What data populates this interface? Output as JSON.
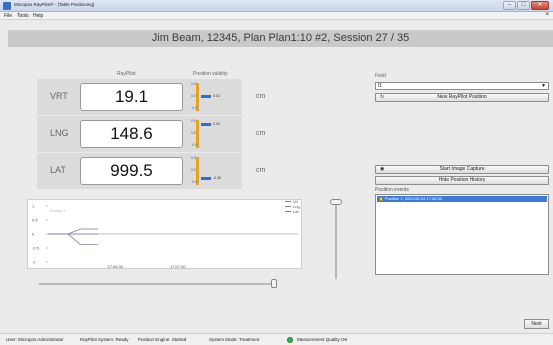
{
  "window": {
    "title": "Micropos RayPilot® - [Table Positioning]"
  },
  "menu": [
    "File",
    "Tools",
    "Help"
  ],
  "session_title": "Jim Beam, 12345, Plan Plan1:10 #2, Session 27 / 35",
  "columns": {
    "raypilot": "RayPilot",
    "position_validity": "Position validity"
  },
  "measurements": [
    {
      "axis": "VRT",
      "value": "19.1",
      "unit": "cm",
      "gauge_ticks": [
        "0.5",
        "0.0",
        "-0.5"
      ],
      "indicator_value": "0.02"
    },
    {
      "axis": "LNG",
      "value": "148.6",
      "unit": "cm",
      "gauge_ticks": [
        "0.5",
        "0.0",
        "-0.5"
      ],
      "indicator_value": "0.00"
    },
    {
      "axis": "LAT",
      "value": "999.5",
      "unit": "cm",
      "gauge_ticks": [
        "0.5",
        "0.0",
        "-0.5"
      ],
      "indicator_value": "-0.38"
    }
  ],
  "chart_data": {
    "type": "line",
    "y_ticks": [
      "1",
      "0.5",
      "0",
      "-0.5",
      "-1"
    ],
    "ylim": [
      -1,
      1
    ],
    "x_ticks": [
      "17:06:30",
      "17:07:00"
    ],
    "annotation": "Position 1",
    "series": [
      {
        "name": "Vrt",
        "values": [
          [
            0,
            0
          ],
          [
            0.08,
            0
          ],
          [
            0.13,
            0.18
          ],
          [
            0.2,
            0.18
          ]
        ]
      },
      {
        "name": "Lng",
        "values": [
          [
            0,
            0
          ],
          [
            0.08,
            0
          ],
          [
            0.13,
            0
          ],
          [
            0.2,
            0
          ]
        ]
      },
      {
        "name": "Lat",
        "values": [
          [
            0,
            0
          ],
          [
            0.08,
            0
          ],
          [
            0.13,
            -0.38
          ],
          [
            0.2,
            -0.38
          ]
        ]
      }
    ],
    "colors": {
      "series": "#7d7ba8",
      "zero_line": "#9aa6c8"
    }
  },
  "right_panel": {
    "field_label": "Field",
    "field_value": "f1",
    "new_position_label": "New RayPilot Position",
    "start_capture_label": "Start Image Capture",
    "hide_history_label": "Hide Position History",
    "events_label": "Position events",
    "events": [
      "Position 1, 2020-06-24 17:06:33"
    ]
  },
  "next_label": "Next",
  "status": {
    "user": "User: Micropos Administrator",
    "system": "RayPilot System: Ready",
    "engine": "Position Engine: Started",
    "mode": "System Mode: Treatment",
    "quality": "Measurement Quality OK"
  },
  "icons": {
    "app": "app-icon",
    "refresh": "refresh-icon",
    "camera": "camera-icon",
    "event": "event-icon",
    "status_ok": "status-ok-icon"
  },
  "colors": {
    "accent": "#3d7ae0",
    "gauge_bar": "#e8a21e",
    "indicator": "#2e6cd6"
  }
}
